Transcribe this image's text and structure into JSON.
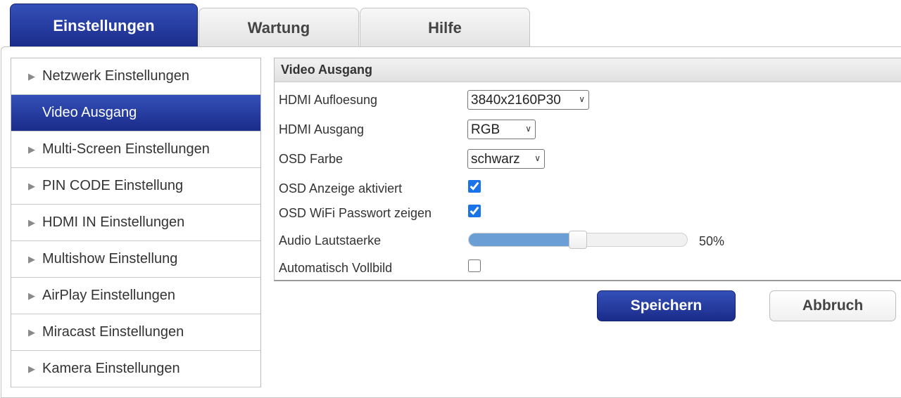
{
  "tabs": [
    {
      "label": "Einstellungen",
      "active": true
    },
    {
      "label": "Wartung",
      "active": false
    },
    {
      "label": "Hilfe",
      "active": false
    }
  ],
  "sidebar": {
    "items": [
      {
        "label": "Netzwerk Einstellungen"
      },
      {
        "label": "Video Ausgang",
        "active": true
      },
      {
        "label": "Multi-Screen Einstellungen"
      },
      {
        "label": "PIN CODE Einstellung"
      },
      {
        "label": "HDMI IN Einstellungen"
      },
      {
        "label": "Multishow Einstellung"
      },
      {
        "label": "AirPlay Einstellungen"
      },
      {
        "label": "Miracast Einstellungen"
      },
      {
        "label": "Kamera Einstellungen"
      }
    ]
  },
  "section": {
    "title": "Video Ausgang",
    "hdmi_resolution": {
      "label": "HDMI Aufloesung",
      "value": "3840x2160P30"
    },
    "hdmi_output": {
      "label": "HDMI Ausgang",
      "value": "RGB"
    },
    "osd_color": {
      "label": "OSD Farbe",
      "value": "schwarz"
    },
    "osd_display": {
      "label": "OSD Anzeige aktiviert",
      "checked": true
    },
    "osd_wifi": {
      "label": "OSD WiFi Passwort zeigen",
      "checked": true
    },
    "audio_volume": {
      "label": "Audio Lautstaerke",
      "value": 50,
      "display": "50%"
    },
    "auto_fullscreen": {
      "label": "Automatisch Vollbild",
      "checked": false
    }
  },
  "buttons": {
    "save": "Speichern",
    "cancel": "Abbruch"
  },
  "colors": {
    "accent_dark": "#1a2b8a",
    "accent_light": "#3450b8",
    "slider_fill": "#6b9ed4",
    "checkbox": "#1a73e8"
  },
  "icons": {
    "sidebar_arrow": "triangle-right-icon",
    "select_chevron": "chevron-down-icon"
  }
}
